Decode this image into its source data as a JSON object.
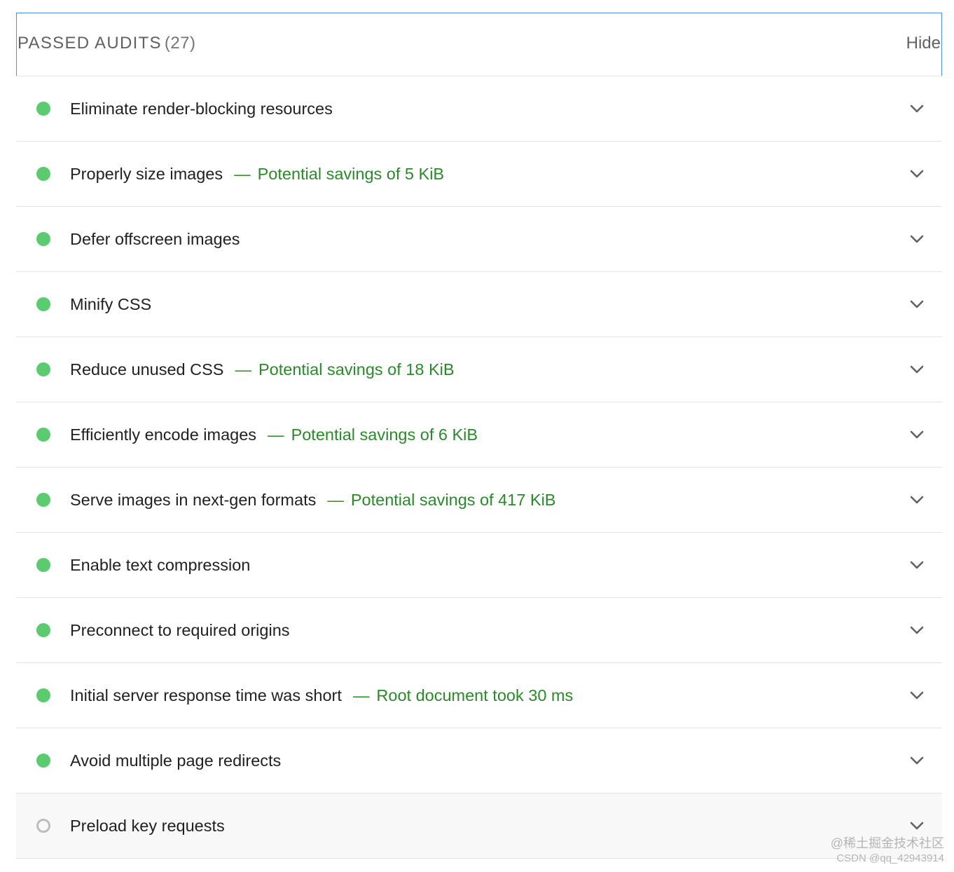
{
  "header": {
    "title": "PASSED AUDITS",
    "count": "(27)",
    "hide_label": "Hide"
  },
  "audits": [
    {
      "title": "Eliminate render-blocking resources",
      "detail": "",
      "status": "pass"
    },
    {
      "title": "Properly size images",
      "detail": "Potential savings of 5 KiB",
      "status": "pass"
    },
    {
      "title": "Defer offscreen images",
      "detail": "",
      "status": "pass"
    },
    {
      "title": "Minify CSS",
      "detail": "",
      "status": "pass"
    },
    {
      "title": "Reduce unused CSS",
      "detail": "Potential savings of 18 KiB",
      "status": "pass"
    },
    {
      "title": "Efficiently encode images",
      "detail": "Potential savings of 6 KiB",
      "status": "pass"
    },
    {
      "title": "Serve images in next-gen formats",
      "detail": "Potential savings of 417 KiB",
      "status": "pass"
    },
    {
      "title": "Enable text compression",
      "detail": "",
      "status": "pass"
    },
    {
      "title": "Preconnect to required origins",
      "detail": "",
      "status": "pass"
    },
    {
      "title": "Initial server response time was short",
      "detail": "Root document took 30 ms",
      "status": "pass"
    },
    {
      "title": "Avoid multiple page redirects",
      "detail": "",
      "status": "pass"
    },
    {
      "title": "Preload key requests",
      "detail": "",
      "status": "informative"
    }
  ],
  "separator": "—",
  "icons": {
    "pass": "green-dot-icon",
    "informative": "gray-ring-icon",
    "expand": "chevron-down-icon"
  },
  "colors": {
    "pass": "#5acc6f",
    "detail_text": "#2a8a2a",
    "header_border": "#4a90e2",
    "informative_ring": "#bdbdbd"
  },
  "watermark": {
    "line1": "@稀土掘金技术社区",
    "line2": "CSDN @qq_42943914"
  }
}
